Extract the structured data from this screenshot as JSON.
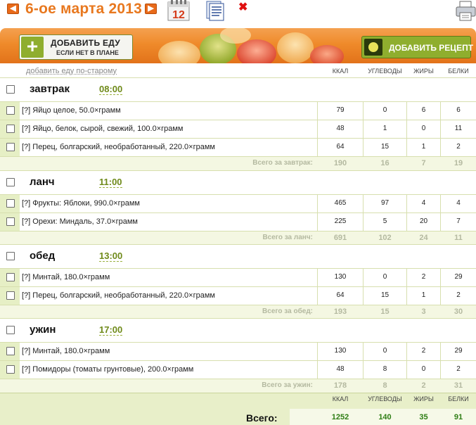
{
  "topbar": {
    "date": "6-ое марта 2013",
    "prev_icon": "arrow-left-icon",
    "next_icon": "arrow-right-icon",
    "calendar_day": "12",
    "delete_glyph": "✖"
  },
  "banner": {
    "add_food_main": "ДОБАВИТЬ ЕДУ",
    "add_food_sub": "ЕСЛИ НЕТ В ПЛАНЕ",
    "add_recipe": "ДОБАВИТЬ РЕЦЕПТ"
  },
  "header": {
    "old_way_link": "добавить еду по-старому",
    "columns": [
      "ККАЛ",
      "УГЛЕВОДЫ",
      "ЖИРЫ",
      "БЕЛКИ"
    ]
  },
  "meals": [
    {
      "name": "завтрак",
      "time": "08:00",
      "items": [
        {
          "name": "[?] Яйцо целое, 50.0×грамм",
          "kcal": "79",
          "carbs": "0",
          "fat": "6",
          "protein": "6"
        },
        {
          "name": "[?] Яйцо, белок, сырой, свежий, 100.0×грамм",
          "kcal": "48",
          "carbs": "1",
          "fat": "0",
          "protein": "11"
        },
        {
          "name": "[?] Перец, болгарский, необработанный, 220.0×грамм",
          "kcal": "64",
          "carbs": "15",
          "fat": "1",
          "protein": "2"
        }
      ],
      "total_label": "Всего за завтрак:",
      "total": {
        "kcal": "190",
        "carbs": "16",
        "fat": "7",
        "protein": "19"
      }
    },
    {
      "name": "ланч",
      "time": "11:00",
      "items": [
        {
          "name": "[?] Фрукты: Яблоки, 990.0×грамм",
          "kcal": "465",
          "carbs": "97",
          "fat": "4",
          "protein": "4"
        },
        {
          "name": "[?] Орехи: Миндаль, 37.0×грамм",
          "kcal": "225",
          "carbs": "5",
          "fat": "20",
          "protein": "7"
        }
      ],
      "total_label": "Всего за ланч:",
      "total": {
        "kcal": "691",
        "carbs": "102",
        "fat": "24",
        "protein": "11"
      }
    },
    {
      "name": "обед",
      "time": "13:00",
      "items": [
        {
          "name": "[?] Минтай, 180.0×грамм",
          "kcal": "130",
          "carbs": "0",
          "fat": "2",
          "protein": "29"
        },
        {
          "name": "[?] Перец, болгарский, необработанный, 220.0×грамм",
          "kcal": "64",
          "carbs": "15",
          "fat": "1",
          "protein": "2"
        }
      ],
      "total_label": "Всего за обед:",
      "total": {
        "kcal": "193",
        "carbs": "15",
        "fat": "3",
        "protein": "30"
      }
    },
    {
      "name": "ужин",
      "time": "17:00",
      "items": [
        {
          "name": "[?] Минтай, 180.0×грамм",
          "kcal": "130",
          "carbs": "0",
          "fat": "2",
          "protein": "29"
        },
        {
          "name": "[?] Помидоры (томаты грунтовые), 200.0×грамм",
          "kcal": "48",
          "carbs": "8",
          "fat": "0",
          "protein": "2"
        }
      ],
      "total_label": "Всего за ужин:",
      "total": {
        "kcal": "178",
        "carbs": "8",
        "fat": "2",
        "protein": "31"
      }
    }
  ],
  "grand_total": {
    "label": "Всего:",
    "columns": [
      "ККАЛ",
      "УГЛЕВОДЫ",
      "ЖИРЫ",
      "БЕЛКИ"
    ],
    "kcal": "1252",
    "carbs": "140",
    "fat": "35",
    "protein": "91"
  },
  "colors": {
    "accent_orange": "#e8781f",
    "accent_green": "#8fae2e",
    "value_green": "#2e7d14"
  }
}
